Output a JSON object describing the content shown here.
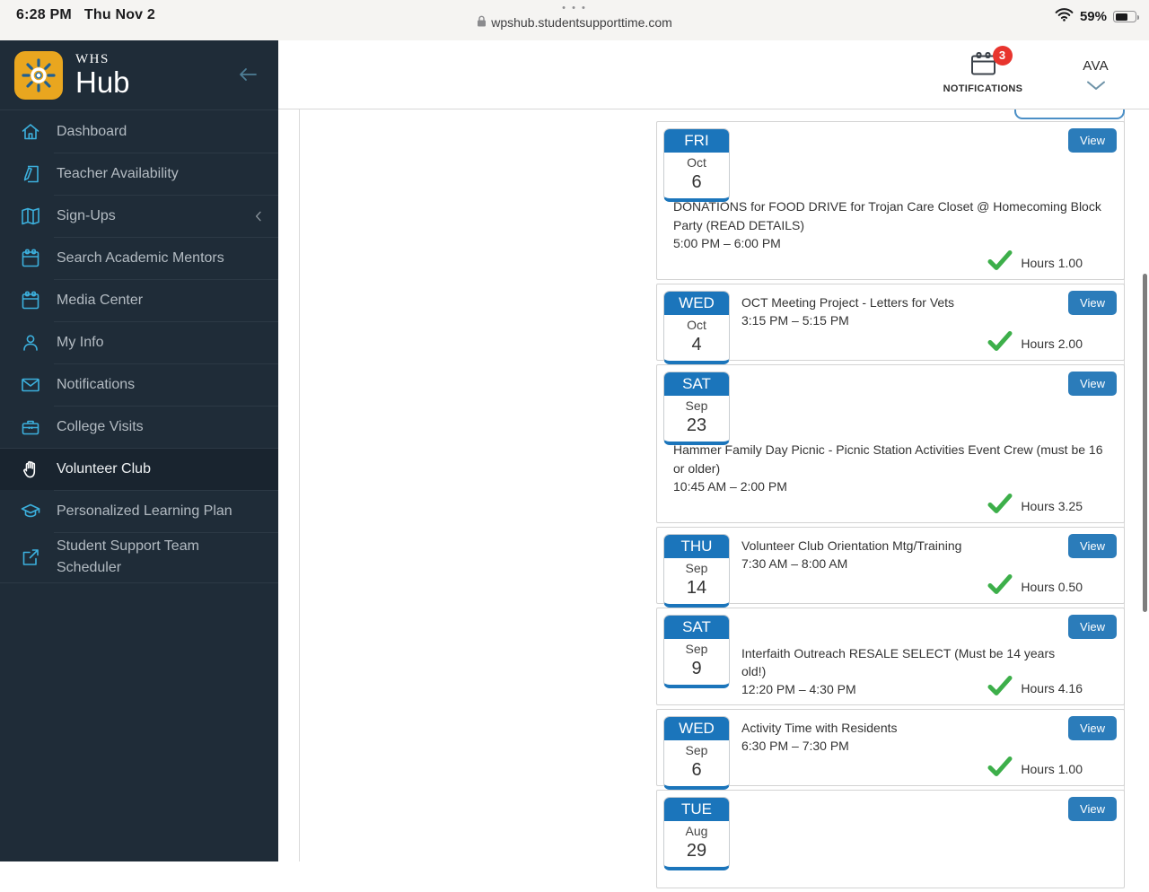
{
  "status_bar": {
    "time": "6:28 PM",
    "date": "Thu Nov 2",
    "tab_dots": "• • •",
    "url": "wpshub.studentsupporttime.com",
    "battery": "59%"
  },
  "sidebar": {
    "brand_top": "WHS",
    "brand_bottom": "Hub",
    "items": [
      {
        "label": "Dashboard",
        "icon": "home-icon"
      },
      {
        "label": "Teacher Availability",
        "icon": "teacher-availability-icon"
      },
      {
        "label": "Sign-Ups",
        "icon": "signups-book-icon",
        "chevron": true
      },
      {
        "label": "Search Academic Mentors",
        "icon": "calendar-icon"
      },
      {
        "label": "Media Center",
        "icon": "calendar-icon"
      },
      {
        "label": "My Info",
        "icon": "person-icon"
      },
      {
        "label": "Notifications",
        "icon": "envelope-icon"
      },
      {
        "label": "College Visits",
        "icon": "briefcase-icon"
      },
      {
        "label": "Volunteer Club",
        "icon": "hand-icon",
        "active": true
      },
      {
        "label": "Personalized Learning Plan",
        "icon": "grad-cap-icon"
      },
      {
        "label": "Student Support Team Scheduler",
        "icon": "external-link-icon"
      }
    ]
  },
  "header": {
    "notifications_label": "NOTIFICATIONS",
    "notifications_count": "3",
    "user": "AVA"
  },
  "ui": {
    "view_label": "View",
    "hours_prefix": "Hours"
  },
  "events": [
    {
      "day": "FRI",
      "month": "Oct",
      "date": "6",
      "title": "DONATIONS for FOOD DRIVE for Trojan Care Closet @ Homecoming Block Party (READ DETAILS)",
      "time": "5:00 PM – 6:00 PM",
      "hours": "1.00",
      "layout": "below"
    },
    {
      "day": "WED",
      "month": "Oct",
      "date": "4",
      "title": "OCT Meeting Project - Letters for Vets",
      "time": "3:15 PM – 5:15 PM",
      "hours": "2.00",
      "layout": "side"
    },
    {
      "day": "SAT",
      "month": "Sep",
      "date": "23",
      "title": "Hammer Family Day Picnic - Picnic Station Activities Event Crew (must be 16 or older)",
      "time": "10:45 AM – 2:00 PM",
      "hours": "3.25",
      "layout": "below"
    },
    {
      "day": "THU",
      "month": "Sep",
      "date": "14",
      "title": "Volunteer Club Orientation Mtg/Training",
      "time": "7:30 AM – 8:00 AM",
      "hours": "0.50",
      "layout": "side"
    },
    {
      "day": "SAT",
      "month": "Sep",
      "date": "9",
      "title": "Interfaith Outreach RESALE SELECT (Must be 14 years old!)",
      "time": "12:20 PM – 4:30 PM",
      "hours": "4.16",
      "layout": "side-offset"
    },
    {
      "day": "WED",
      "month": "Sep",
      "date": "6",
      "title": "Activity Time with Residents",
      "time": "6:30 PM – 7:30 PM",
      "hours": "1.00",
      "layout": "side"
    },
    {
      "day": "TUE",
      "month": "Aug",
      "date": "29",
      "title": "",
      "time": "",
      "hours": "",
      "layout": "cut"
    }
  ],
  "colors": {
    "accent_blue": "#1b75bb",
    "view_button_blue": "#2b7cba",
    "badge_red": "#e8352e",
    "check_green": "#3daf4a",
    "sidebar_bg": "#1f2c38",
    "sidebar_icon_cyan": "#3cb0dd"
  }
}
